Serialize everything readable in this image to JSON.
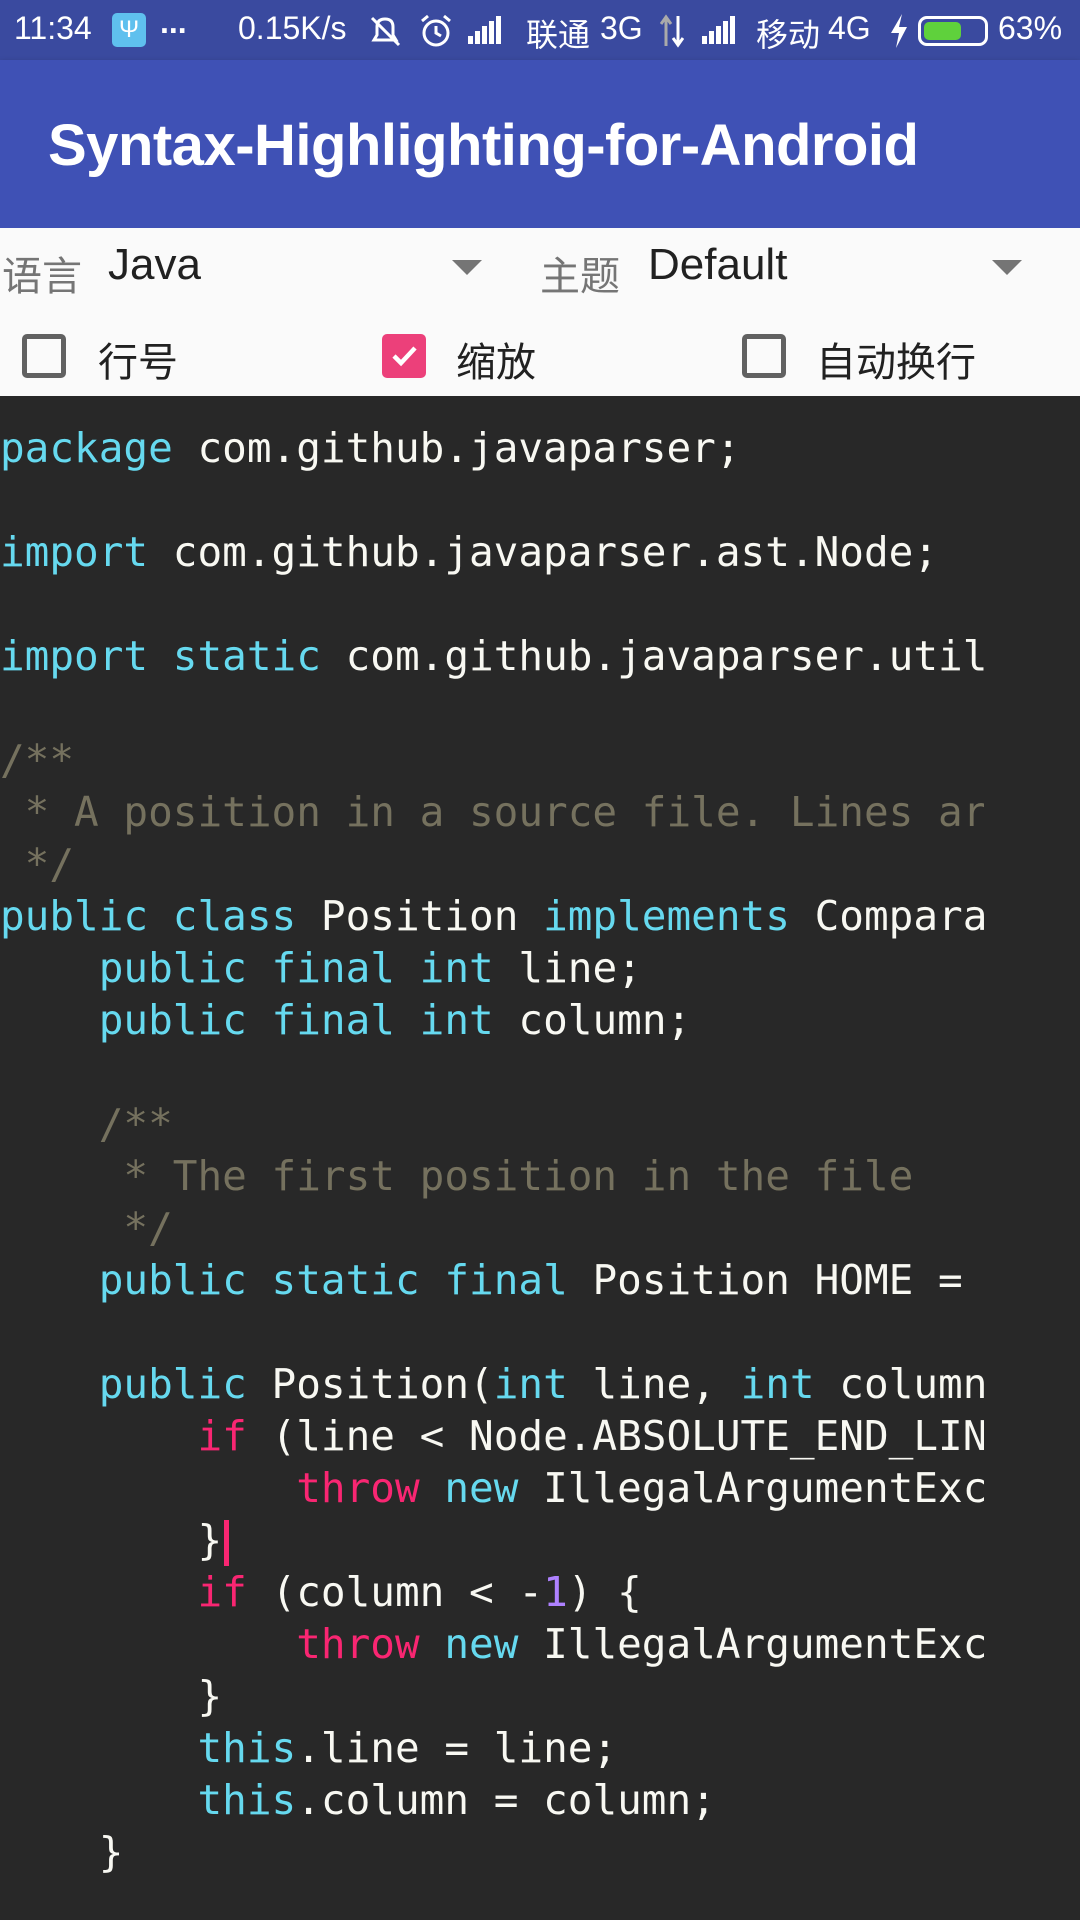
{
  "status_bar": {
    "time": "11:34",
    "usb_glyph": "Ψ",
    "more": "...",
    "net_speed": "0.15K/s",
    "carrier1": "联通",
    "net1": "3G",
    "carrier2": "移动",
    "net2": "4G",
    "battery_pct": "63%",
    "battery_level": 0.63
  },
  "app_bar": {
    "title": "Syntax-Highlighting-for-Android"
  },
  "controls": {
    "language_label": "语言",
    "language_value": "Java",
    "theme_label": "主题",
    "theme_value": "Default",
    "line_numbers_label": "行号",
    "line_numbers_checked": false,
    "zoom_label": "缩放",
    "zoom_checked": true,
    "word_wrap_label": "自动换行",
    "word_wrap_checked": false
  },
  "colors": {
    "app_bar": "#3f51b5",
    "accent": "#ec407a",
    "editor_bg": "#282828",
    "keyword": "#66d9ef",
    "control_keyword": "#f92672",
    "comment": "#75715e",
    "number": "#ae81ff",
    "plain": "#f8f8f2"
  },
  "code_lines": [
    [
      [
        "kw",
        "package"
      ],
      [
        "p",
        " com.github.javaparser;"
      ]
    ],
    [],
    [
      [
        "kw",
        "import"
      ],
      [
        "p",
        " com.github.javaparser.ast.Node;"
      ]
    ],
    [],
    [
      [
        "kw",
        "import"
      ],
      [
        "p",
        " "
      ],
      [
        "kw",
        "static"
      ],
      [
        "p",
        " com.github.javaparser.util"
      ]
    ],
    [],
    [
      [
        "cm",
        "/**"
      ]
    ],
    [
      [
        "cm",
        " * A position in a source file. Lines ar"
      ]
    ],
    [
      [
        "cm",
        " */"
      ]
    ],
    [
      [
        "kw",
        "public"
      ],
      [
        "p",
        " "
      ],
      [
        "kw",
        "class"
      ],
      [
        "p",
        " Position "
      ],
      [
        "kw",
        "implements"
      ],
      [
        "p",
        " Compara"
      ]
    ],
    [
      [
        "p",
        "    "
      ],
      [
        "kw",
        "public"
      ],
      [
        "p",
        " "
      ],
      [
        "kw",
        "final"
      ],
      [
        "p",
        " "
      ],
      [
        "kw",
        "int"
      ],
      [
        "p",
        " line;"
      ]
    ],
    [
      [
        "p",
        "    "
      ],
      [
        "kw",
        "public"
      ],
      [
        "p",
        " "
      ],
      [
        "kw",
        "final"
      ],
      [
        "p",
        " "
      ],
      [
        "kw",
        "int"
      ],
      [
        "p",
        " column;"
      ]
    ],
    [],
    [
      [
        "p",
        "    "
      ],
      [
        "cm",
        "/**"
      ]
    ],
    [
      [
        "cm",
        "     * The first position in the file"
      ]
    ],
    [
      [
        "cm",
        "     */"
      ]
    ],
    [
      [
        "p",
        "    "
      ],
      [
        "kw",
        "public"
      ],
      [
        "p",
        " "
      ],
      [
        "kw",
        "static"
      ],
      [
        "p",
        " "
      ],
      [
        "kw",
        "final"
      ],
      [
        "p",
        " Position HOME ="
      ]
    ],
    [],
    [
      [
        "p",
        "    "
      ],
      [
        "kw",
        "public"
      ],
      [
        "p",
        " Position("
      ],
      [
        "kw",
        "int"
      ],
      [
        "p",
        " line, "
      ],
      [
        "kw",
        "int"
      ],
      [
        "p",
        " column"
      ]
    ],
    [
      [
        "p",
        "        "
      ],
      [
        "ctl",
        "if"
      ],
      [
        "p",
        " (line < Node.ABSOLUTE_END_LIN"
      ]
    ],
    [
      [
        "p",
        "            "
      ],
      [
        "ctl",
        "throw"
      ],
      [
        "p",
        " "
      ],
      [
        "kw",
        "new"
      ],
      [
        "p",
        " IllegalArgumentExc"
      ]
    ],
    [
      [
        "p",
        "        }"
      ],
      [
        "cursor",
        ""
      ]
    ],
    [
      [
        "p",
        "        "
      ],
      [
        "ctl",
        "if"
      ],
      [
        "p",
        " (column < -"
      ],
      [
        "num",
        "1"
      ],
      [
        "p",
        ") {"
      ]
    ],
    [
      [
        "p",
        "            "
      ],
      [
        "ctl",
        "throw"
      ],
      [
        "p",
        " "
      ],
      [
        "kw",
        "new"
      ],
      [
        "p",
        " IllegalArgumentExc"
      ]
    ],
    [
      [
        "p",
        "        }"
      ]
    ],
    [
      [
        "p",
        "        "
      ],
      [
        "kw",
        "this"
      ],
      [
        "p",
        ".line = line;"
      ]
    ],
    [
      [
        "p",
        "        "
      ],
      [
        "kw",
        "this"
      ],
      [
        "p",
        ".column = column;"
      ]
    ],
    [
      [
        "p",
        "    }"
      ]
    ]
  ]
}
